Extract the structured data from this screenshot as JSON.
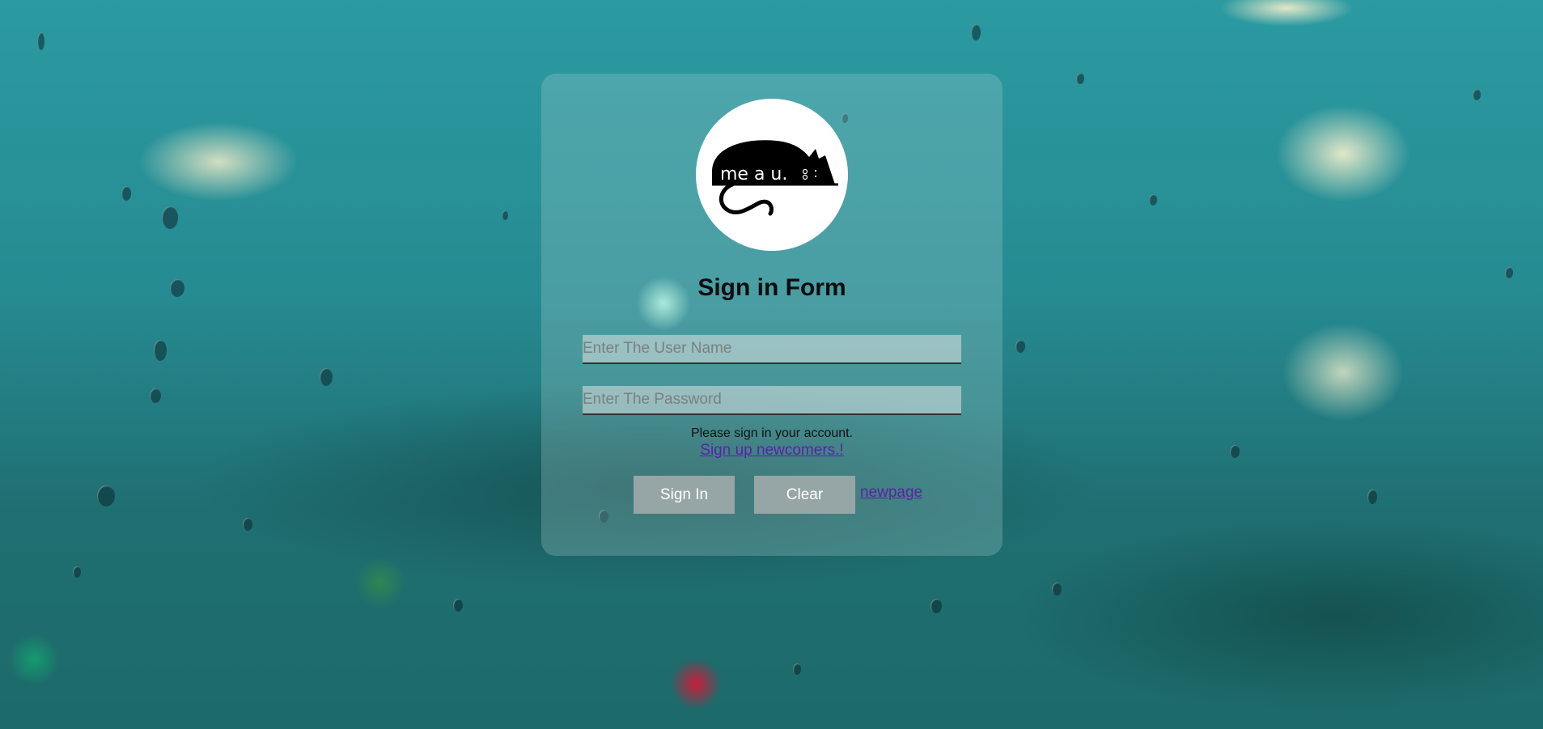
{
  "logo": {
    "icon": "cat-logo",
    "text": "me a u."
  },
  "form": {
    "title": "Sign in Form",
    "username_placeholder": "Enter The User Name",
    "password_placeholder": "Enter The Password",
    "hint": "Please sign in your account.",
    "signup_link": "Sign up newcomers.!",
    "signin_button": "Sign In",
    "clear_button": "Clear",
    "newpage_link": "newpage"
  },
  "colors": {
    "background": "#2a8b94",
    "link": "#5a22a8",
    "button": "#a0aaaa"
  }
}
